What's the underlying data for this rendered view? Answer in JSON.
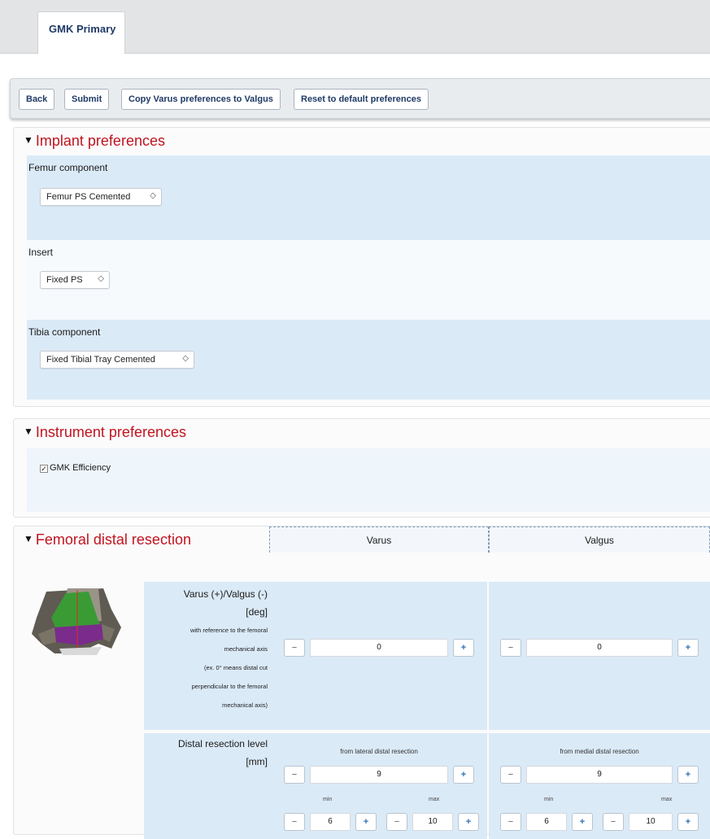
{
  "tabs": [
    {
      "label": "GMK Primary"
    }
  ],
  "toolbar": {
    "back": "Back",
    "submit": "Submit",
    "copy": "Copy Varus preferences to Valgus",
    "reset": "Reset to default preferences"
  },
  "implant": {
    "title": "Implant preferences",
    "femur": {
      "label": "Femur component",
      "value": "Femur PS Cemented"
    },
    "insert": {
      "label": "Insert",
      "value": "Fixed PS"
    },
    "tibia": {
      "label": "Tibia component",
      "value": "Fixed Tibial Tray Cemented"
    }
  },
  "instrument": {
    "title": "Instrument preferences",
    "checkbox": {
      "label": "GMK Efficiency",
      "checked": true,
      "mark": "✓"
    }
  },
  "resection": {
    "title": "Femoral distal resection",
    "columns": [
      "Varus",
      "Valgus"
    ],
    "angle_row": {
      "label_lines": [
        "Varus (+)/Valgus (-)",
        "[deg]"
      ],
      "note_lines": [
        "with reference to the femoral",
        "mechanical axis",
        "(ex. 0° means distal cut",
        "perpendicular to the femoral",
        "mechanical axis)"
      ],
      "varus_value": "0",
      "valgus_value": "0"
    },
    "level_row": {
      "label_lines": [
        "Distal resection level",
        "[mm]"
      ],
      "varus_caption": "from lateral distal resection",
      "valgus_caption": "from medial distal resection",
      "varus_value": "9",
      "valgus_value": "9",
      "min_label": "min",
      "max_label": "max",
      "varus_min": "6",
      "varus_max": "10",
      "valgus_min": "6",
      "valgus_max": "10"
    }
  },
  "stepper": {
    "minus": "−",
    "plus": "+"
  },
  "colors": {
    "title_red": "#c0141f",
    "row_blue": "#dbeaf7",
    "femur_green": "#3a9b35",
    "femur_purple": "#7a2b8c"
  }
}
